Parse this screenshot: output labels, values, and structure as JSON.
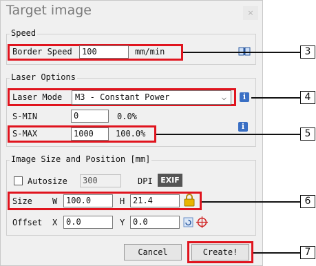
{
  "window": {
    "title": "Target image",
    "close_glyph": "×"
  },
  "speed": {
    "legend": "Speed",
    "border_speed_label": "Border Speed",
    "border_speed_value": "100",
    "unit": "mm/min",
    "icon": "book-icon"
  },
  "laser": {
    "legend": "Laser Options",
    "mode_label": "Laser Mode",
    "mode_value": "M3 - Constant Power",
    "smin_label": "S-MIN",
    "smin_value": "0",
    "smin_percent": "0.0%",
    "smax_label": "S-MAX",
    "smax_value": "1000",
    "smax_percent": "100.0%",
    "info_glyph": "i"
  },
  "image": {
    "legend": "Image Size and Position [mm]",
    "autosize_label": "Autosize",
    "dpi_value": "300",
    "dpi_label": "DPI",
    "exif_label": "EXIF",
    "size_label": "Size",
    "w_label": "W",
    "w_value": "100.0",
    "h_label": "H",
    "h_value": "21.4",
    "offset_label": "Offset",
    "x_label": "X",
    "x_value": "0.0",
    "y_label": "Y",
    "y_value": "0.0"
  },
  "buttons": {
    "cancel": "Cancel",
    "create": "Create!"
  },
  "callouts": [
    "3",
    "4",
    "5",
    "6",
    "7"
  ],
  "colors": {
    "highlight": "#e0141e",
    "dialog_bg": "#f0f0f0",
    "info_blue": "#3a6fc4",
    "lock": "#e8b400"
  }
}
